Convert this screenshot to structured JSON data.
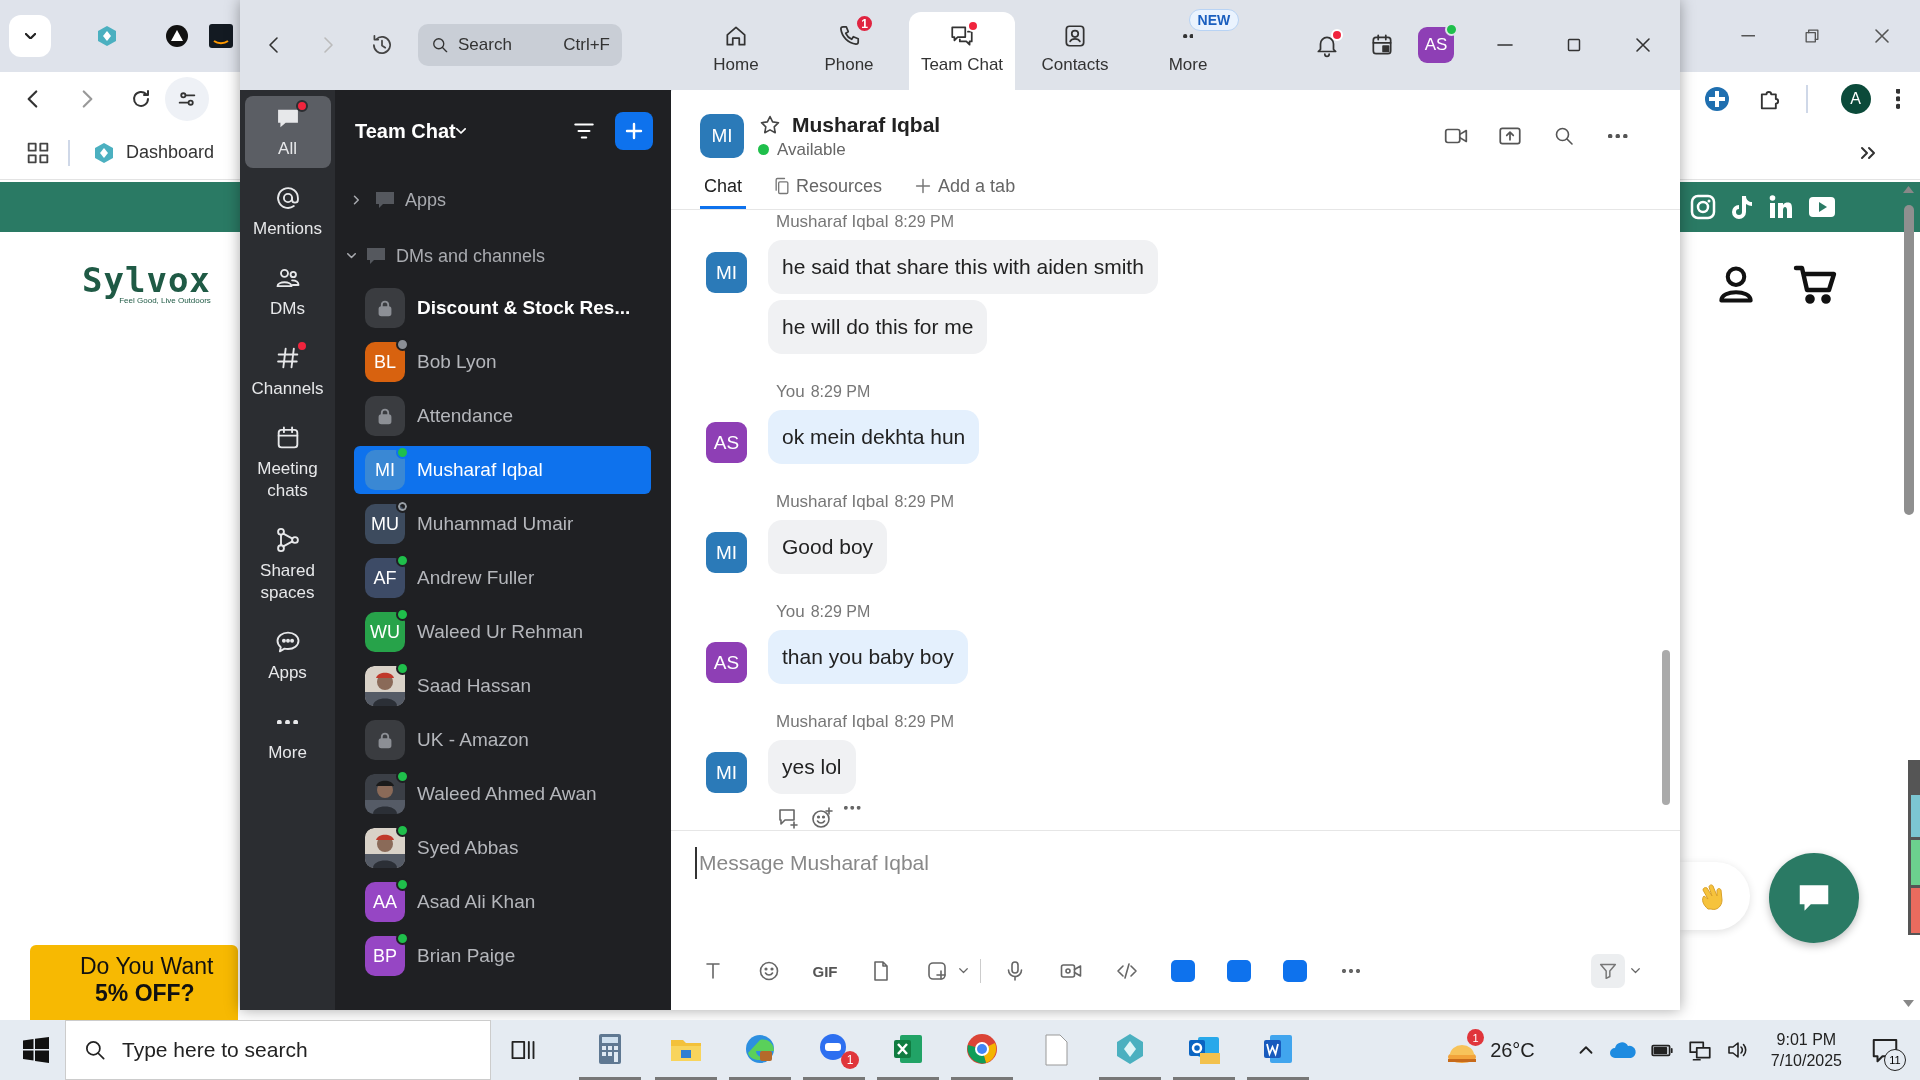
{
  "browser": {
    "bookmark": "Dashboard",
    "profile_initial": "A",
    "site_logo": {
      "name": "Sylvox",
      "tagline": "Feel Good, Live Outdoors"
    },
    "promo": [
      "Do You Want",
      "5% OFF?"
    ]
  },
  "zoom": {
    "topbar": {
      "search": {
        "placeholder": "Search",
        "shortcut": "Ctrl+F"
      },
      "tabs": [
        {
          "label": "Home",
          "selected": false,
          "dot": false
        },
        {
          "label": "Phone",
          "selected": false,
          "dot": false,
          "badge": "1"
        },
        {
          "label": "Team Chat",
          "selected": true,
          "dot": true
        },
        {
          "label": "Contacts",
          "selected": false,
          "dot": false
        },
        {
          "label": "More",
          "selected": false,
          "dot": false,
          "tag": "NEW"
        }
      ],
      "notification_dot": true,
      "avatar": {
        "initials": "AS",
        "color": "#8e3fb5",
        "online": true
      }
    },
    "nav": [
      {
        "label": "All",
        "selected": true,
        "dot": true
      },
      {
        "label": "Mentions",
        "selected": false,
        "dot": false
      },
      {
        "label": "DMs",
        "selected": false,
        "dot": false
      },
      {
        "label": "Channels",
        "selected": false,
        "dot": true
      },
      {
        "label": "Meeting chats",
        "selected": false,
        "dot": false
      },
      {
        "label": "Shared spaces",
        "selected": false,
        "dot": false
      },
      {
        "label": "Apps",
        "selected": false,
        "dot": false
      },
      {
        "label": "More",
        "selected": false,
        "dot": false
      }
    ],
    "list": {
      "title": "Team Chat",
      "sections": [
        {
          "label": "Apps",
          "expanded": false
        },
        {
          "label": "DMs and channels",
          "expanded": true
        }
      ],
      "items": [
        {
          "kind": "channel",
          "name": "Discount & Stock Res...",
          "unread": true,
          "selected": false
        },
        {
          "kind": "initials",
          "name": "Bob Lyon",
          "initials": "BL",
          "color": "#d8620f",
          "online": false,
          "away": true,
          "unread": false,
          "selected": false
        },
        {
          "kind": "channel",
          "name": "Attendance",
          "unread": false,
          "selected": false
        },
        {
          "kind": "initials",
          "name": "Musharaf Iqbal",
          "initials": "MI",
          "color": "#3a88d4",
          "online": true,
          "away": false,
          "unread": false,
          "selected": true
        },
        {
          "kind": "initials",
          "name": "Muhammad Umair",
          "initials": "MU",
          "color": "#3d4b5e",
          "online": false,
          "away": false,
          "unread": false,
          "selected": false
        },
        {
          "kind": "initials",
          "name": "Andrew Fuller",
          "initials": "AF",
          "color": "#3d4b66",
          "online": true,
          "away": false,
          "unread": false,
          "selected": false
        },
        {
          "kind": "initials",
          "name": "Waleed Ur Rehman",
          "initials": "WU",
          "color": "#27a34a",
          "online": true,
          "away": false,
          "unread": false,
          "selected": false
        },
        {
          "name": "Saad Hassan",
          "online": true,
          "away": false,
          "unread": false,
          "selected": false
        },
        {
          "kind": "channel",
          "name": "UK - Amazon",
          "unread": false,
          "selected": false
        },
        {
          "name": "Waleed Ahmed Awan",
          "online": true,
          "away": false,
          "unread": false,
          "selected": false
        },
        {
          "name": "Syed Abbas",
          "online": true,
          "away": false,
          "unread": false,
          "selected": false
        },
        {
          "kind": "initials",
          "name": "Asad Ali Khan",
          "initials": "AA",
          "color": "#9646c4",
          "online": true,
          "away": false,
          "unread": false,
          "selected": false
        },
        {
          "kind": "initials",
          "name": "Brian Paige",
          "initials": "BP",
          "color": "#9646c4",
          "online": true,
          "away": false,
          "unread": false,
          "selected": false
        }
      ]
    },
    "conversation": {
      "initials": "MI",
      "color": "#2b7ab8",
      "name": "Musharaf Iqbal",
      "starred": false,
      "online": true,
      "status": "Available",
      "tabs": [
        {
          "label": "Chat",
          "selected": true
        },
        {
          "label": "Resources",
          "selected": false
        },
        {
          "label": "Add a tab",
          "selected": false
        }
      ],
      "messages": [
        {
          "sender": "Musharaf Iqbal",
          "time": "8:29 PM",
          "initials": "MI",
          "color": "#2b7ab8",
          "mine": false,
          "actions": false,
          "bubbles": [
            "he said that share this with aiden smith",
            "he will do this for me"
          ]
        },
        {
          "sender": "You",
          "time": "8:29 PM",
          "initials": "AS",
          "color": "#8e3fb5",
          "mine": true,
          "actions": false,
          "bubbles": [
            "ok mein dekhta hun"
          ]
        },
        {
          "sender": "Musharaf Iqbal",
          "time": "8:29 PM",
          "initials": "MI",
          "color": "#2b7ab8",
          "mine": false,
          "actions": false,
          "bubbles": [
            "Good boy"
          ]
        },
        {
          "sender": "You",
          "time": "8:29 PM",
          "initials": "AS",
          "color": "#8e3fb5",
          "mine": true,
          "actions": false,
          "bubbles": [
            "than you baby boy"
          ]
        },
        {
          "sender": "Musharaf Iqbal",
          "time": "8:29 PM",
          "initials": "MI",
          "color": "#2b7ab8",
          "mine": false,
          "actions": true,
          "bubbles": [
            "yes lol"
          ]
        }
      ],
      "composer": {
        "placeholder": "Message Musharaf Iqbal",
        "gif_label": "GIF"
      }
    }
  },
  "taskbar": {
    "search_placeholder": "Type here to search",
    "zoom_badge": "1",
    "weather_badge": "1",
    "temperature": "26°C",
    "time": "9:01 PM",
    "date": "7/10/2025",
    "notifications": "11"
  }
}
